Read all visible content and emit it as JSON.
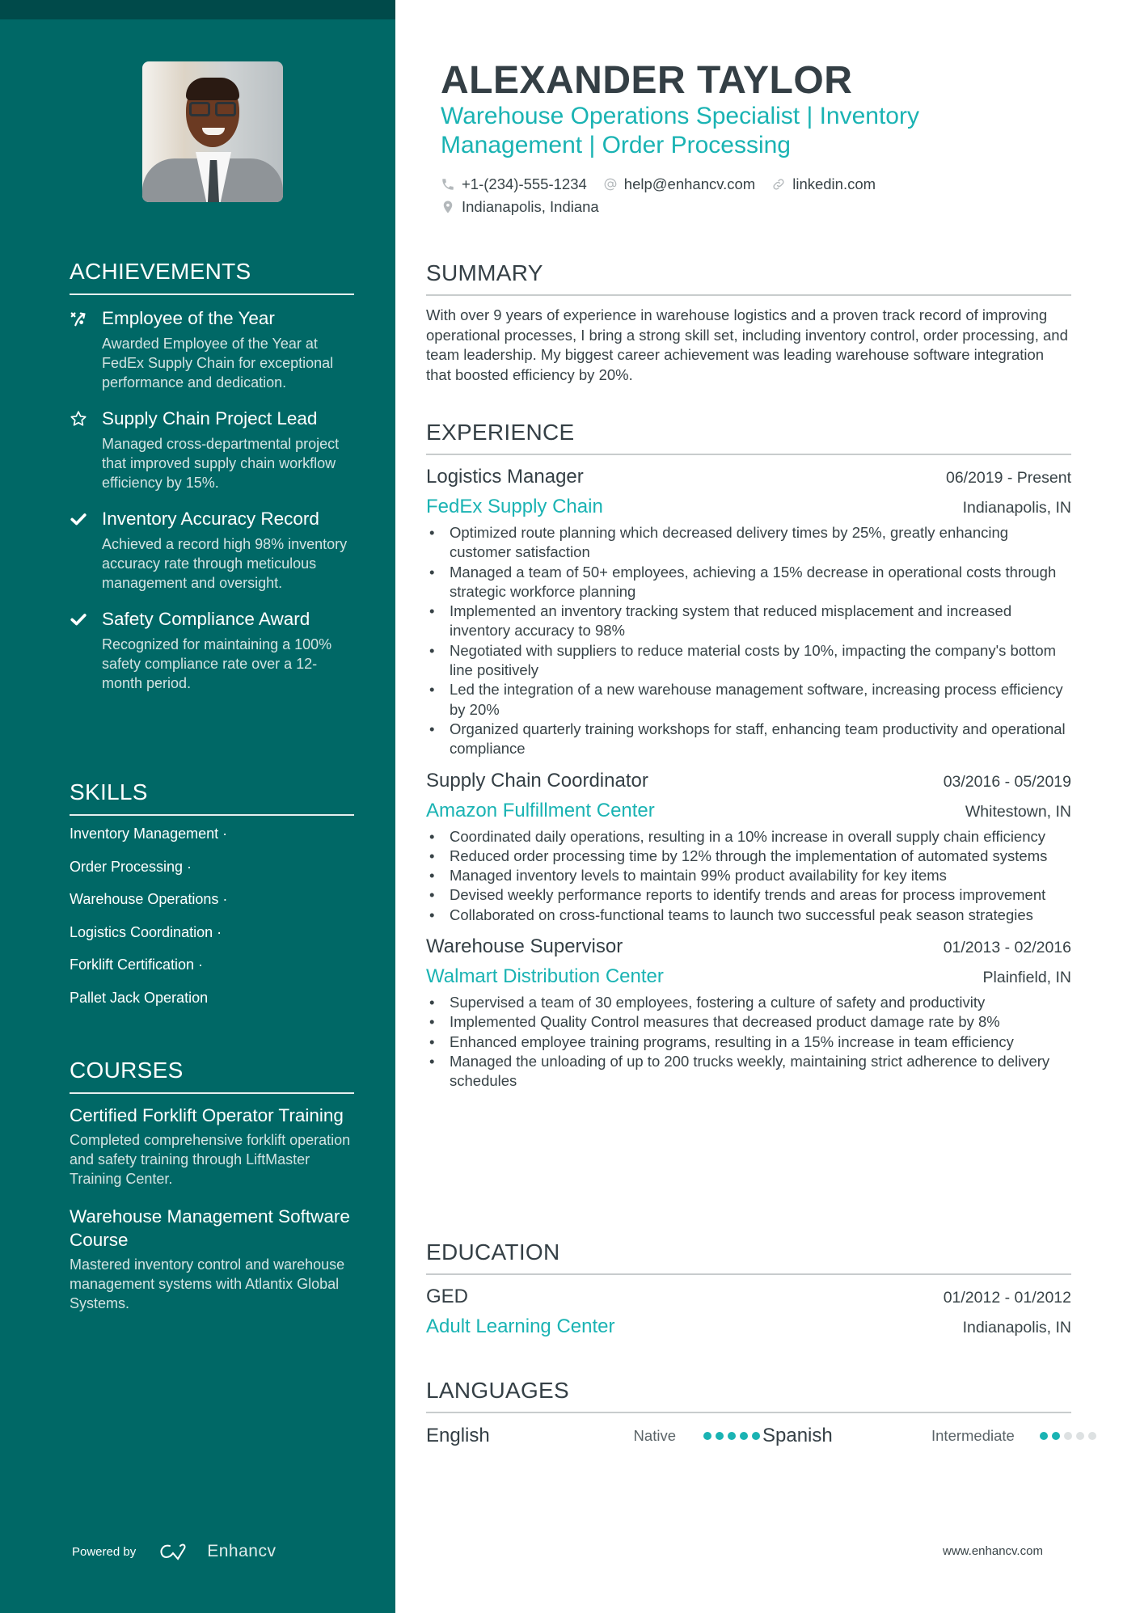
{
  "colors": {
    "sidebar": "#006866",
    "sidebar_top": "#004a4a",
    "accent": "#1ab3b3",
    "text_dark": "#343f45"
  },
  "header": {
    "name": "ALEXANDER TAYLOR",
    "headline": "Warehouse Operations Specialist | Inventory Management | Order Processing",
    "contacts": {
      "phone": {
        "icon": "phone-icon",
        "value": "+1-(234)-555-1234"
      },
      "email": {
        "icon": "at-icon",
        "value": "help@enhancv.com"
      },
      "link": {
        "icon": "link-icon",
        "value": "linkedin.com"
      },
      "location": {
        "icon": "location-pin-icon",
        "value": "Indianapolis, Indiana"
      }
    }
  },
  "sidebar": {
    "achievements": {
      "title": "ACHIEVEMENTS",
      "items": [
        {
          "icon": "strategy-icon",
          "title": "Employee of the Year",
          "description": "Awarded Employee of the Year at FedEx Supply Chain for exceptional performance and dedication."
        },
        {
          "icon": "star-icon",
          "title": "Supply Chain Project Lead",
          "description": "Managed cross-departmental project that improved supply chain workflow efficiency by 15%."
        },
        {
          "icon": "check-icon",
          "title": "Inventory Accuracy Record",
          "description": "Achieved a record high 98% inventory accuracy rate through meticulous management and oversight."
        },
        {
          "icon": "check-icon",
          "title": "Safety Compliance Award",
          "description": "Recognized for maintaining a 100% safety compliance rate over a 12-month period."
        }
      ]
    },
    "skills": {
      "title": "SKILLS",
      "items": [
        "Inventory Management ·",
        "Order Processing ·",
        "Warehouse Operations ·",
        "Logistics Coordination ·",
        "Forklift Certification ·",
        "Pallet Jack Operation"
      ]
    },
    "courses": {
      "title": "COURSES",
      "items": [
        {
          "title": "Certified Forklift Operator Training",
          "description": "Completed comprehensive forklift operation and safety training through LiftMaster Training Center."
        },
        {
          "title": "Warehouse Management Software Course",
          "description": "Mastered inventory control and warehouse management systems with Atlantix Global Systems."
        }
      ]
    },
    "footer": {
      "powered_by": "Powered by",
      "brand": "Enhancv"
    }
  },
  "summary": {
    "title": "SUMMARY",
    "text": "With over 9 years of experience in warehouse logistics and a proven track record of improving operational processes, I bring a strong skill set, including inventory control, order processing, and team leadership. My biggest career achievement was leading warehouse software integration that boosted efficiency by 20%."
  },
  "experience": {
    "title": "EXPERIENCE",
    "jobs": [
      {
        "title": "Logistics Manager",
        "dates": "06/2019 - Present",
        "company": "FedEx Supply Chain",
        "location": "Indianapolis, IN",
        "bullets": [
          "Optimized route planning which decreased delivery times by 25%, greatly enhancing customer satisfaction",
          "Managed a team of 50+ employees, achieving a 15% decrease in operational costs through strategic workforce planning",
          "Implemented an inventory tracking system that reduced misplacement and increased inventory accuracy to 98%",
          "Negotiated with suppliers to reduce material costs by 10%, impacting the company's bottom line positively",
          "Led the integration of a new warehouse management software, increasing process efficiency by 20%",
          "Organized quarterly training workshops for staff, enhancing team productivity and operational compliance"
        ]
      },
      {
        "title": "Supply Chain Coordinator",
        "dates": "03/2016 - 05/2019",
        "company": "Amazon Fulfillment Center",
        "location": "Whitestown, IN",
        "bullets": [
          "Coordinated daily operations, resulting in a 10% increase in overall supply chain efficiency",
          "Reduced order processing time by 12% through the implementation of automated systems",
          "Managed inventory levels to maintain 99% product availability for key items",
          "Devised weekly performance reports to identify trends and areas for process improvement",
          "Collaborated on cross-functional teams to launch two successful peak season strategies"
        ]
      },
      {
        "title": "Warehouse Supervisor",
        "dates": "01/2013 - 02/2016",
        "company": "Walmart Distribution Center",
        "location": "Plainfield, IN",
        "bullets": [
          "Supervised a team of 30 employees, fostering a culture of safety and productivity",
          "Implemented Quality Control measures that decreased product damage rate by 8%",
          "Enhanced employee training programs, resulting in a 15% increase in team efficiency",
          "Managed the unloading of up to 200 trucks weekly, maintaining strict adherence to delivery schedules"
        ]
      }
    ]
  },
  "education": {
    "title": "EDUCATION",
    "items": [
      {
        "degree": "GED",
        "dates": "01/2012 - 01/2012",
        "school": "Adult Learning Center",
        "location": "Indianapolis, IN"
      }
    ]
  },
  "languages": {
    "title": "LANGUAGES",
    "items": [
      {
        "name": "English",
        "level": "Native",
        "rating": 5,
        "max": 5
      },
      {
        "name": "Spanish",
        "level": "Intermediate",
        "rating": 2,
        "max": 5
      }
    ]
  },
  "footer": {
    "url": "www.enhancv.com"
  }
}
